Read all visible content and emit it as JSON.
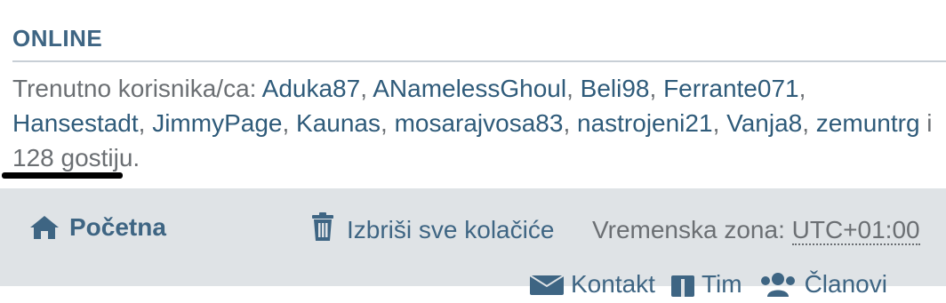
{
  "online": {
    "heading": "ONLINE",
    "prefix": "Trenutno korisnika/ca:",
    "users": [
      "Aduka87",
      "ANamelessGhoul",
      "Beli98",
      "Ferrante071",
      "Hansestadt",
      "JimmyPage",
      "Kaunas",
      "mosarajvosa83",
      "nastrojeni21",
      "Vanja8",
      "zemuntrg"
    ],
    "separator": ",",
    "suffix": "i 128 gostiju."
  },
  "footer": {
    "home_label": "Početna",
    "home_icon": "home-icon",
    "delete_cookies_label": "Izbriši sve kolačiće",
    "delete_icon": "trash-icon",
    "timezone_label": "Vremenska zona:",
    "timezone_value": "UTC+01:00",
    "bottom_items": [
      {
        "label": "Kontakt",
        "icon": "envelope-icon"
      },
      {
        "label": "Tim",
        "icon": "shield-icon"
      },
      {
        "label": "Članovi",
        "icon": "users-icon"
      }
    ]
  },
  "colors": {
    "link": "#2f5b7a",
    "heading": "#3e6583",
    "text": "#6b6f73",
    "footer_bg": "#dfe3e6"
  }
}
